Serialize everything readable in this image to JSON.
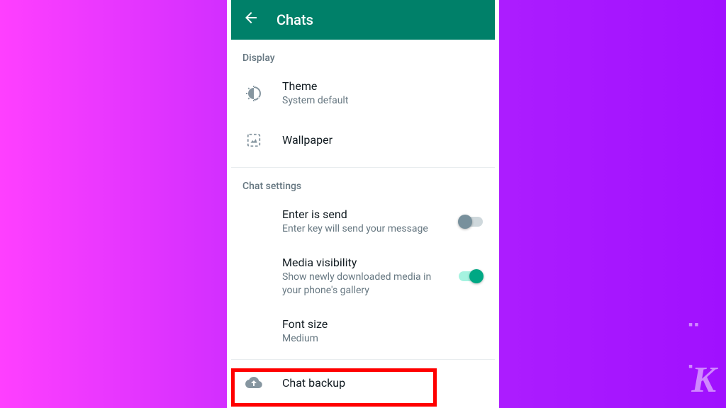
{
  "header": {
    "title": "Chats"
  },
  "sections": {
    "display": {
      "header": "Display",
      "theme": {
        "title": "Theme",
        "subtitle": "System default"
      },
      "wallpaper": {
        "title": "Wallpaper"
      }
    },
    "chat_settings": {
      "header": "Chat settings",
      "enter_is_send": {
        "title": "Enter is send",
        "subtitle": "Enter key will send your message",
        "enabled": false
      },
      "media_visibility": {
        "title": "Media visibility",
        "subtitle": "Show newly downloaded media in your phone's gallery",
        "enabled": true
      },
      "font_size": {
        "title": "Font size",
        "subtitle": "Medium"
      },
      "chat_backup": {
        "title": "Chat backup"
      }
    }
  },
  "watermark": "K",
  "colors": {
    "header_bg": "#008069",
    "accent_on": "#00a884",
    "highlight_border": "#ff0000"
  }
}
